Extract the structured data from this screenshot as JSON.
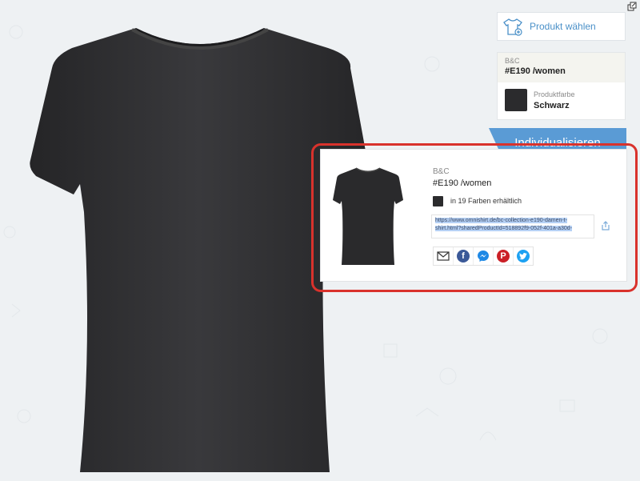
{
  "product_selector": {
    "label": "Produkt wählen",
    "icon": "tshirt-icon"
  },
  "product_info": {
    "brand": "B&C",
    "model": "#E190 /women",
    "color_label": "Produktfarbe",
    "color_name": "Schwarz",
    "color_hex": "#2b2b2d"
  },
  "customize_button": {
    "label": "Individualisieren",
    "color": "#5a9bd5"
  },
  "share_card": {
    "brand": "B&C",
    "model": "#E190 /women",
    "colors_text": "in 19 Farben erhältlich",
    "url": "https://www.omnishirt.de/bc-collection-e190-damen-t-shirt.html?sharedProductId=518892f9-052f-401a-a30d-",
    "share_icon": "share-icon",
    "social_buttons": [
      "email-icon",
      "facebook-icon",
      "messenger-icon",
      "pinterest-icon",
      "twitter-icon"
    ]
  },
  "colors": {
    "highlight_frame": "#d9322c",
    "accent": "#4a90c8",
    "shirt": "#2b2b2d"
  }
}
